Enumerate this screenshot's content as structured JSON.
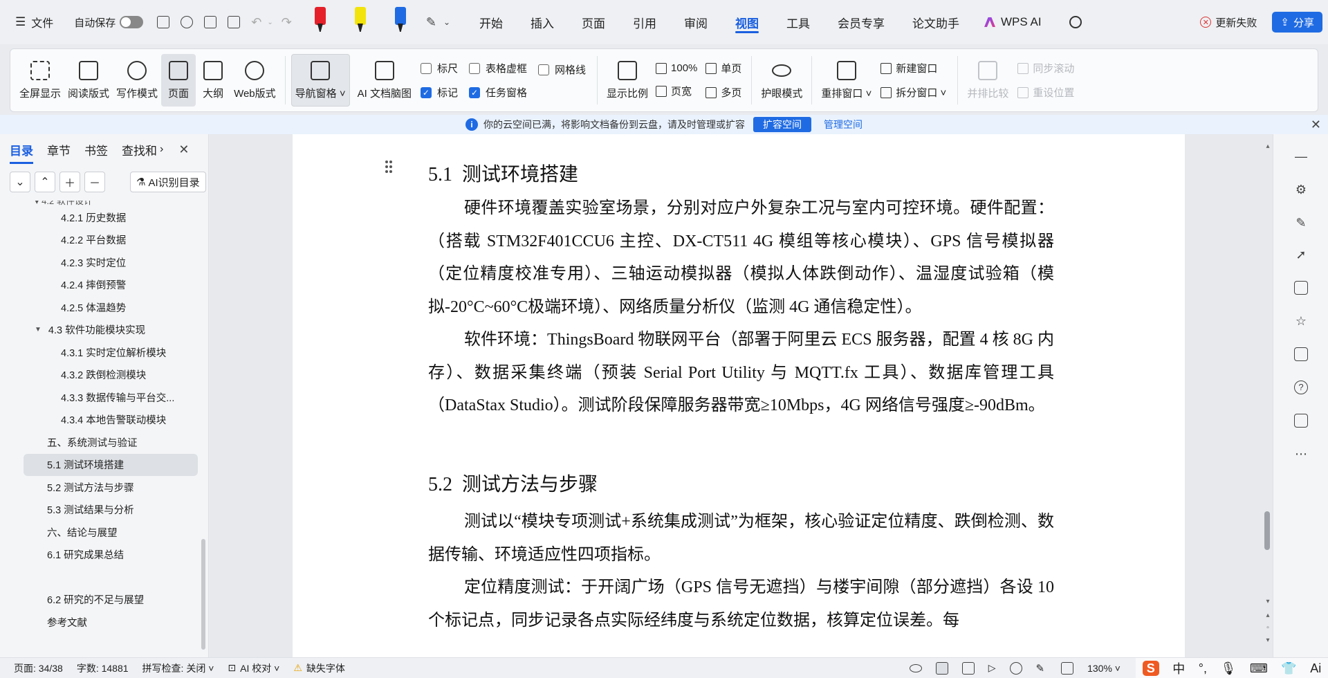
{
  "topbar": {
    "menu_icon": "☰",
    "file_label": "文件",
    "autosave_label": "自动保存",
    "tabs": [
      {
        "label": "开始"
      },
      {
        "label": "插入"
      },
      {
        "label": "页面"
      },
      {
        "label": "引用"
      },
      {
        "label": "审阅"
      },
      {
        "label": "视图"
      },
      {
        "label": "工具"
      },
      {
        "label": "会员专享"
      },
      {
        "label": "论文助手"
      }
    ],
    "wps_ai_label": "WPS AI",
    "update_failed_label": "更新失败",
    "share_label": "分享",
    "marker_colors": [
      "#e5202a",
      "#f2e30c",
      "#1f6be3"
    ]
  },
  "ribbon": {
    "big_buttons_1": [
      {
        "label": "全屏显示"
      },
      {
        "label": "阅读版式"
      },
      {
        "label": "写作模式"
      },
      {
        "label": "页面"
      },
      {
        "label": "大纲"
      },
      {
        "label": "Web版式"
      }
    ],
    "nav_pane_label": "导航窗格",
    "mindmap_label": "AI 文档脑图",
    "checkbox_col1": [
      {
        "label": "标尺",
        "checked": false
      },
      {
        "label": "标记",
        "checked": true
      }
    ],
    "checkbox_col2": [
      {
        "label": "表格虚框",
        "checked": false
      },
      {
        "label": "任务窗格",
        "checked": true
      }
    ],
    "checkbox_col3": [
      {
        "label": "网格线",
        "checked": false
      }
    ],
    "zoom_label": "显示比例",
    "zoom_100_label": "100%",
    "page_width_label": "页宽",
    "single_page_label": "单页",
    "multi_page_label": "多页",
    "eye_mode_label": "护眼模式",
    "rearrange_label": "重排窗口",
    "new_window_label": "新建窗口",
    "split_window_label": "拆分窗口",
    "side_by_side_label": "并排比较",
    "sync_scroll_label": "同步滚动",
    "reset_pos_label": "重设位置"
  },
  "notice": {
    "text": "你的云空间已满，将影响文档备份到云盘，请及时管理或扩容",
    "expand_label": "扩容空间",
    "manage_label": "管理空间"
  },
  "leftpanel": {
    "tabs": [
      {
        "label": "目录"
      },
      {
        "label": "章节"
      },
      {
        "label": "书签"
      },
      {
        "label": "查找和"
      }
    ],
    "ai_toc_label": "AI识别目录",
    "toc": [
      {
        "label": "4.2.1  历史数据",
        "level": 3
      },
      {
        "label": "4.2.2  平台数据",
        "level": 3
      },
      {
        "label": "4.2.3  实时定位",
        "level": 3
      },
      {
        "label": "4.2.4  摔倒预警",
        "level": 3
      },
      {
        "label": "4.2.5  体温趋势",
        "level": 3
      },
      {
        "label": "4.3  软件功能模块实现",
        "level": 2,
        "expanded": true
      },
      {
        "label": "4.3.1  实时定位解析模块",
        "level": 3
      },
      {
        "label": "4.3.2  跌倒检测模块",
        "level": 3
      },
      {
        "label": "4.3.3  数据传输与平台交...",
        "level": 3
      },
      {
        "label": "4.3.4  本地告警联动模块",
        "level": 3
      },
      {
        "label": "五、系统测试与验证",
        "level": 1
      },
      {
        "label": "5.1  测试环境搭建",
        "level": 1,
        "selected": true
      },
      {
        "label": "5.2  测试方法与步骤",
        "level": 1
      },
      {
        "label": "5.3  测试结果与分析",
        "level": 1
      },
      {
        "label": "六、结论与展望",
        "level": 1
      },
      {
        "label": "6.1  研究成果总结",
        "level": 1
      },
      {
        "label": "",
        "level": 1
      },
      {
        "label": "6.2  研究的不足与展望",
        "level": 1
      },
      {
        "label": "参考文献",
        "level": 1
      }
    ]
  },
  "document": {
    "h51_num": "5.1",
    "h51_title": "测试环境搭建",
    "p1": "硬件环境覆盖实验室场景，分别对应户外复杂工况与室内可控环境。硬件配置：（搭载 STM32F401CCU6 主控、DX-CT511 4G 模组等核心模块）、GPS 信号模拟器（定位精度校准专用）、三轴运动模拟器（模拟人体跌倒动作）、温湿度试验箱（模拟-20°C~60°C极端环境）、网络质量分析仪（监测 4G 通信稳定性）。",
    "p2": "软件环境：ThingsBoard 物联网平台（部署于阿里云 ECS 服务器，配置 4 核 8G 内存）、数据采集终端（预装 Serial Port Utility 与 MQTT.fx 工具）、数据库管理工具（DataStax Studio）。测试阶段保障服务器带宽≥10Mbps，4G 网络信号强度≥-90dBm。",
    "h52_num": "5.2",
    "h52_title": "测试方法与步骤",
    "p3": "测试以“模块专项测试+系统集成测试”为框架，核心验证定位精度、跌倒检测、数据传输、环境适应性四项指标。",
    "p4": "定位精度测试：于开阔广场（GPS 信号无遮挡）与楼宇间隙（部分遮挡）各设 10 个标记点，同步记录各点实际经纬度与系统定位数据，核算定位误差。每"
  },
  "statusbar": {
    "page_label": "页面: 34/38",
    "words_label": "字数: 14881",
    "spell_label": "拼写检查: 关闭",
    "ai_check_label": "AI 校对",
    "missing_font_label": "缺失字体",
    "zoom_label": "130%"
  },
  "ime": {
    "logo": "S",
    "lang": "中",
    "punct": "°,",
    "ai": "Ai"
  }
}
